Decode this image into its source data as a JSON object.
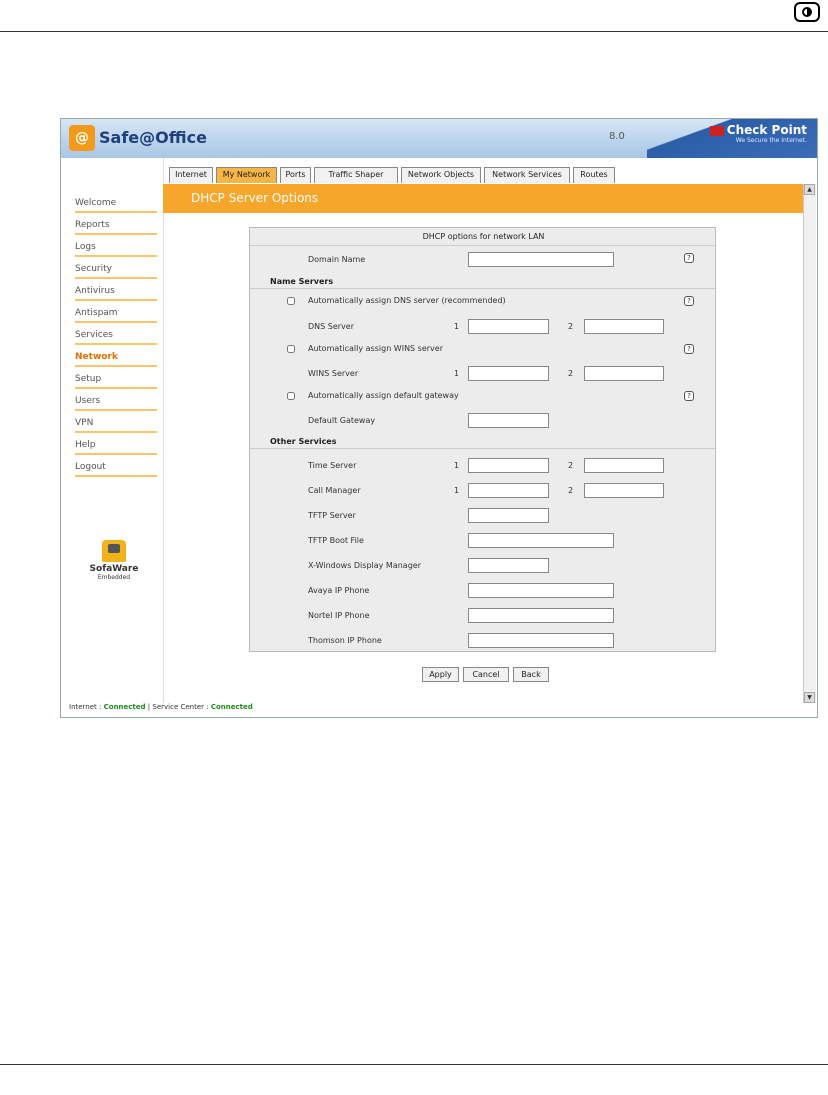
{
  "app": {
    "title": "Safe@Office",
    "logo_icon": "safe-at-office-logo-icon",
    "version": "8.0",
    "brand": "Check Point",
    "tagline": "We Secure the Internet."
  },
  "sidebar": {
    "items": [
      {
        "label": "Welcome"
      },
      {
        "label": "Reports"
      },
      {
        "label": "Logs"
      },
      {
        "label": "Security"
      },
      {
        "label": "Antivirus"
      },
      {
        "label": "Antispam"
      },
      {
        "label": "Services"
      },
      {
        "label": "Network",
        "active": true
      },
      {
        "label": "Setup"
      },
      {
        "label": "Users"
      },
      {
        "label": "VPN"
      },
      {
        "label": "Help"
      },
      {
        "label": "Logout"
      }
    ],
    "sofaware": {
      "name": "SofaWare",
      "sub": "Embedded"
    }
  },
  "tabs": [
    {
      "label": "Internet"
    },
    {
      "label": "My Network",
      "active": true
    },
    {
      "label": "Ports"
    },
    {
      "label": "Traffic Shaper"
    },
    {
      "label": "Network Objects"
    },
    {
      "label": "Network Services"
    },
    {
      "label": "Routes"
    }
  ],
  "page_title": "DHCP Server Options",
  "panel": {
    "title": "DHCP options for network LAN",
    "domain_name": {
      "label": "Domain Name",
      "value": ""
    },
    "name_servers": {
      "heading": "Name Servers",
      "auto_dns": {
        "label": "Automatically assign DNS server (recommended)",
        "checked": false
      },
      "dns_server": {
        "label": "DNS Server",
        "idx1": "1",
        "idx2": "2",
        "value1": "",
        "value2": ""
      },
      "auto_wins": {
        "label": "Automatically assign WINS server",
        "checked": false
      },
      "wins_server": {
        "label": "WINS Server",
        "idx1": "1",
        "idx2": "2",
        "value1": "",
        "value2": ""
      },
      "auto_gateway": {
        "label": "Automatically assign default gateway",
        "checked": false
      },
      "default_gateway": {
        "label": "Default Gateway",
        "value": ""
      }
    },
    "other_services": {
      "heading": "Other Services",
      "time_server": {
        "label": "Time Server",
        "idx1": "1",
        "idx2": "2"
      },
      "call_manager": {
        "label": "Call Manager",
        "idx1": "1",
        "idx2": "2"
      },
      "tftp_server": {
        "label": "TFTP Server"
      },
      "tftp_boot_file": {
        "label": "TFTP Boot File"
      },
      "xdm": {
        "label": "X-Windows Display Manager"
      },
      "avaya": {
        "label": "Avaya IP Phone"
      },
      "nortel": {
        "label": "Nortel IP Phone"
      },
      "thomson": {
        "label": "Thomson IP Phone"
      }
    },
    "help_glyph": "?"
  },
  "buttons": {
    "apply": "Apply",
    "cancel": "Cancel",
    "back": "Back"
  },
  "status": {
    "internet_label": "Internet :",
    "internet_value": "Connected",
    "separator": "|",
    "service_label": "Service Center :",
    "service_value": "Connected"
  },
  "colors": {
    "accent": "#f6a62a",
    "header": "#b9d2ec",
    "connected": "#1e8a1e"
  }
}
